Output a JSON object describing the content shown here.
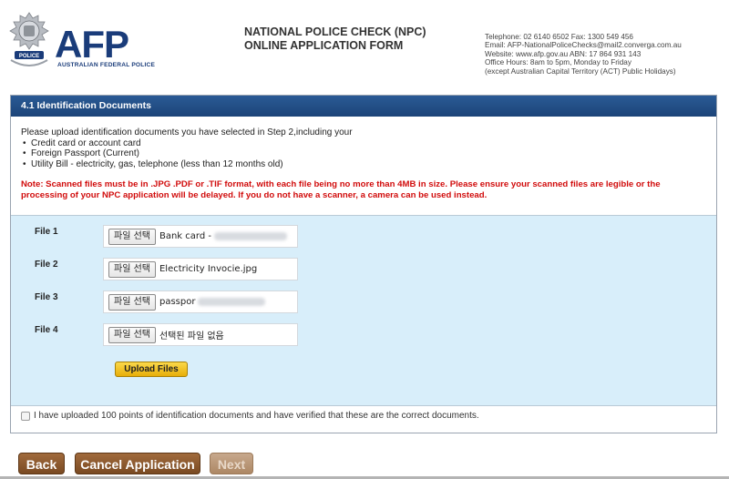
{
  "header": {
    "logo": "AFP",
    "logo_sub": "AUSTRALIAN FEDERAL POLICE",
    "title_line1": "NATIONAL POLICE CHECK (NPC)",
    "title_line2": "ONLINE APPLICATION FORM",
    "contact": [
      "Telephone: 02 6140 6502  Fax: 1300 549 456",
      "Email: AFP-NationalPoliceChecks@mail2.converga.com.au",
      "Website: www.afp.gov.au    ABN: 17 864 931 143",
      "Office Hours: 8am to 5pm, Monday to Friday",
      "(except Australian Capital Territory (ACT) Public Holidays)"
    ]
  },
  "section": {
    "title": "4.1 Identification Documents",
    "intro": "Please upload identification documents you have selected in Step 2,including your",
    "items": [
      "Credit card or account card",
      "Foreign Passport (Current)",
      "Utility Bill - electricity, gas, telephone (less than 12 months old)"
    ],
    "note": "Note: Scanned files must be in .JPG .PDF or .TIF format, with each file being no more than 4MB in size. Please ensure your scanned files are legible or the processing of your NPC application will be delayed. If you do not have a scanner, a camera can be used instead."
  },
  "files": [
    {
      "label": "File 1",
      "button": "파일 선택",
      "value": "Bank card -"
    },
    {
      "label": "File 2",
      "button": "파일 선택",
      "value": "Electricity Invocie.jpg"
    },
    {
      "label": "File 3",
      "button": "파일 선택",
      "value": "passpor"
    },
    {
      "label": "File 4",
      "button": "파일 선택",
      "value": "선택된 파일 없음"
    }
  ],
  "upload_label": "Upload Files",
  "confirm_text": "I have uploaded 100 points of identification documents and have verified that these are the correct documents.",
  "nav": {
    "back": "Back",
    "cancel": "Cancel Application",
    "next": "Next"
  }
}
